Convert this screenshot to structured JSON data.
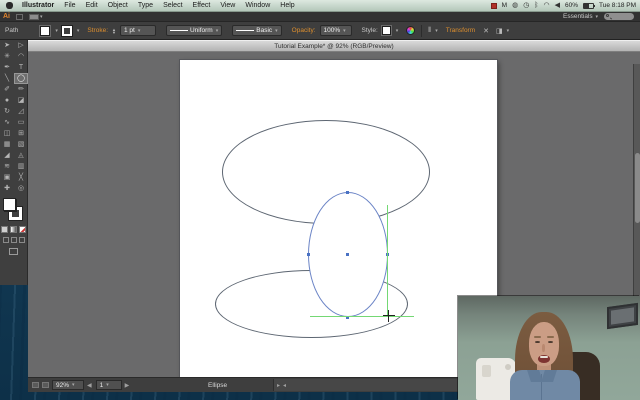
{
  "menubar": {
    "menus": [
      "Illustrator",
      "File",
      "Edit",
      "Object",
      "Type",
      "Select",
      "Effect",
      "View",
      "Window",
      "Help"
    ],
    "status": {
      "app_badge": "M",
      "timemachine_glyph": "◍",
      "clock_glyph": "◷",
      "bluetooth_glyph": "ᛒ",
      "wifi_glyph": "◠",
      "volume_glyph": "◀",
      "battery": "60%",
      "datetime": "Tue 8:18 PM"
    }
  },
  "app_bar": {
    "logo": "Ai",
    "workspace": "Essentials"
  },
  "control_bar": {
    "selection_label": "Path",
    "stroke_label": "Stroke:",
    "stroke_weight": "1 pt",
    "variable_width": "Uniform",
    "brush_definition": "Basic",
    "opacity_label": "Opacity:",
    "opacity_value": "100%",
    "style_label": "Style:",
    "transform_label": "Transform"
  },
  "document": {
    "tab_title": "Tutorial Example* @ 92% (RGB/Preview)"
  },
  "status_bar": {
    "zoom": "92%",
    "artboard": "1",
    "tool_status": "Ellipse",
    "nav_back": "◀",
    "nav_fwd": "▶",
    "scroll_left": "◂",
    "scroll_right": "▸"
  },
  "tools": {
    "items": [
      {
        "name": "selection",
        "glyph": "➤"
      },
      {
        "name": "direct-selection",
        "glyph": "▷"
      },
      {
        "name": "magic-wand",
        "glyph": "✳"
      },
      {
        "name": "lasso",
        "glyph": "◠"
      },
      {
        "name": "pen",
        "glyph": "✒"
      },
      {
        "name": "type",
        "glyph": "T"
      },
      {
        "name": "line-segment",
        "glyph": "╲"
      },
      {
        "name": "ellipse",
        "glyph": "◯",
        "selected": true
      },
      {
        "name": "paintbrush",
        "glyph": "✐"
      },
      {
        "name": "pencil",
        "glyph": "✏"
      },
      {
        "name": "blob-brush",
        "glyph": "●"
      },
      {
        "name": "eraser",
        "glyph": "◪"
      },
      {
        "name": "rotate",
        "glyph": "↻"
      },
      {
        "name": "scale",
        "glyph": "◿"
      },
      {
        "name": "width",
        "glyph": "∿"
      },
      {
        "name": "free-transform",
        "glyph": "▭"
      },
      {
        "name": "shape-builder",
        "glyph": "◫"
      },
      {
        "name": "perspective-grid",
        "glyph": "⊞"
      },
      {
        "name": "mesh",
        "glyph": "▦"
      },
      {
        "name": "gradient",
        "glyph": "▧"
      },
      {
        "name": "eyedropper",
        "glyph": "◢"
      },
      {
        "name": "blend",
        "glyph": "◬"
      },
      {
        "name": "symbol-sprayer",
        "glyph": "≋"
      },
      {
        "name": "column-graph",
        "glyph": "▥"
      },
      {
        "name": "artboard",
        "glyph": "▣"
      },
      {
        "name": "slice",
        "glyph": "╳"
      },
      {
        "name": "hand",
        "glyph": "✚"
      },
      {
        "name": "zoom",
        "glyph": "◎"
      }
    ]
  },
  "colors": {
    "accent_orange": "#de8f2e",
    "selection_blue": "#4a72c4",
    "smart_guide_green": "#74d874",
    "ui_dark": "#3e3e3e",
    "pasteboard_gray": "#6a6a6b"
  }
}
